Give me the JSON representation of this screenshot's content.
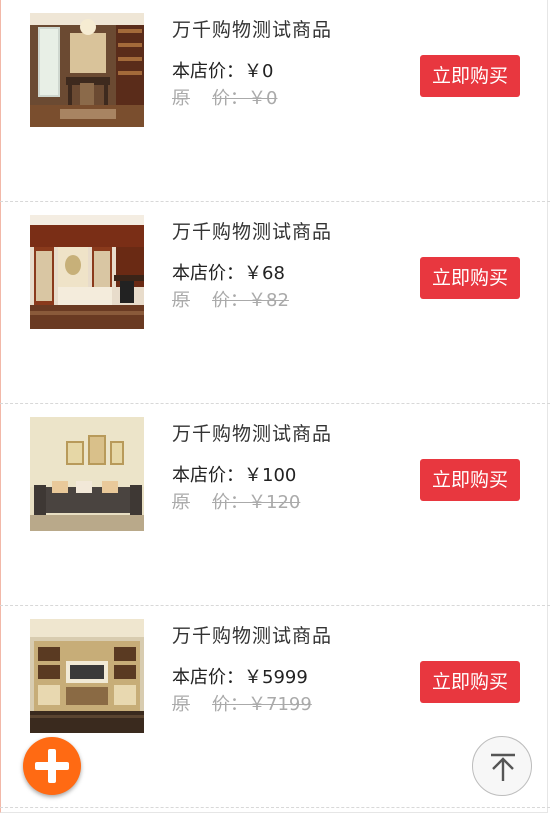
{
  "products": [
    {
      "name": "万千购物测试商品",
      "price_label": "本店价：",
      "price": "￥0",
      "orig_label_a": "原",
      "orig_label_b": "价：",
      "orig_price": "￥0",
      "buy_label": "立即购买",
      "image": "study-room-image"
    },
    {
      "name": "万千购物测试商品",
      "price_label": "本店价：",
      "price": "￥68",
      "orig_label_a": "原",
      "orig_label_b": "价：",
      "orig_price": "￥82",
      "buy_label": "立即购买",
      "image": "wood-cabinet-image"
    },
    {
      "name": "万千购物测试商品",
      "price_label": "本店价：",
      "price": "￥100",
      "orig_label_a": "原",
      "orig_label_b": "价：",
      "orig_price": "￥120",
      "buy_label": "立即购买",
      "image": "living-room-sofa-image"
    },
    {
      "name": "万千购物测试商品",
      "price_label": "本店价：",
      "price": "￥5999",
      "orig_label_a": "原",
      "orig_label_b": "价：",
      "orig_price": "￥7199",
      "buy_label": "立即购买",
      "image": "tv-cabinet-image"
    }
  ],
  "icons": {
    "add": "plus-icon",
    "top": "back-to-top-icon"
  },
  "colors": {
    "buy_button": "#e8373f",
    "add_button": "#ff6a13",
    "original_price": "#aaaaaa"
  }
}
